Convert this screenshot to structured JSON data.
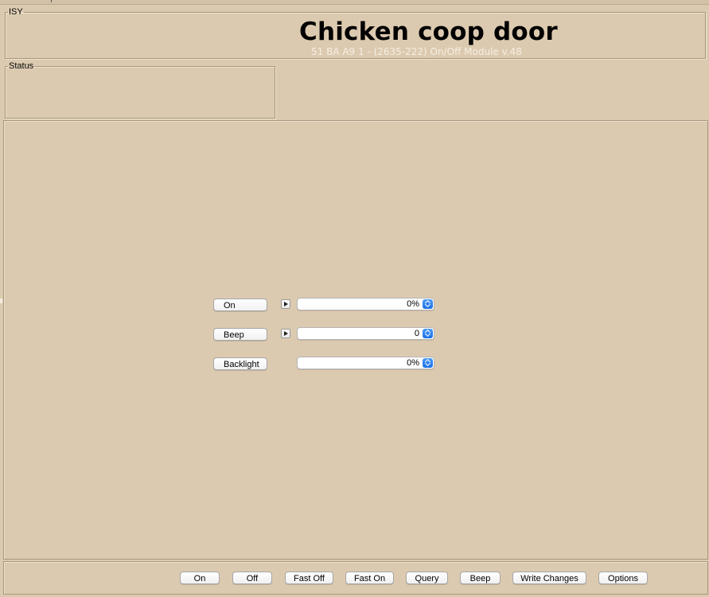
{
  "isy_group": {
    "legend": "ISY"
  },
  "device": {
    "name": "Chicken coop door",
    "info": "51 BA A9 1 - (2635-222) On/Off Module v.48"
  },
  "status_group": {
    "legend": "Status"
  },
  "controls": [
    {
      "label": "On",
      "has_arrow": true,
      "value": "0%"
    },
    {
      "label": "Beep",
      "has_arrow": true,
      "value": "0"
    },
    {
      "label": "Backlight",
      "has_arrow": false,
      "value": "0%"
    }
  ],
  "toolbar": {
    "on": "On",
    "off": "Off",
    "fast_off": "Fast Off",
    "fast_on": "Fast On",
    "query": "Query",
    "beep": "Beep",
    "write_changes": "Write Changes",
    "options": "Options"
  },
  "colors": {
    "background": "#dccab0",
    "spinner_accent": "#1a6fe6"
  }
}
